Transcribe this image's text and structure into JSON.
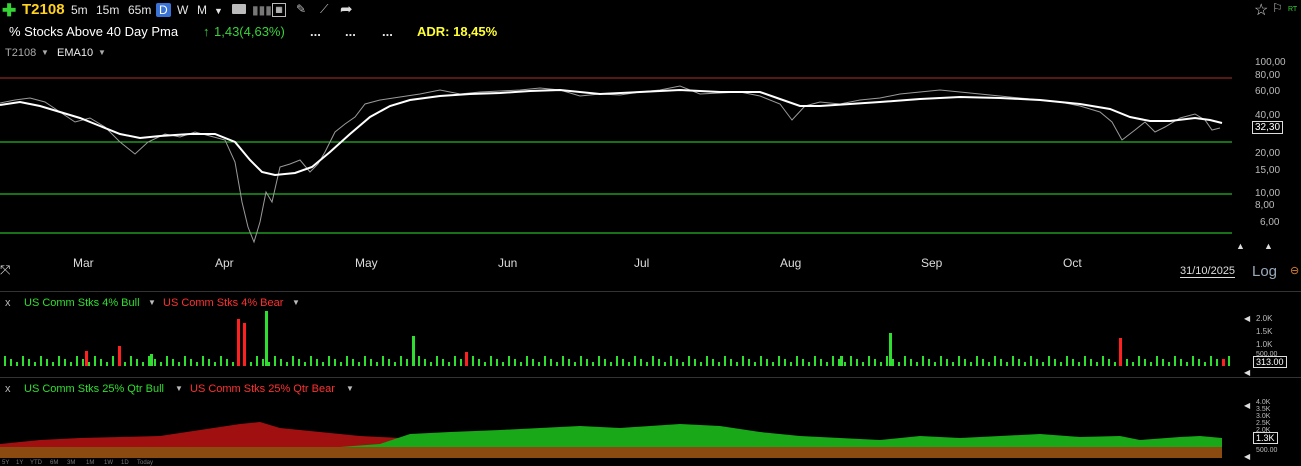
{
  "toolbar": {
    "ticker": "T2108",
    "timeframes": [
      "5m",
      "15m",
      "65m",
      "D",
      "W",
      "M"
    ],
    "active_timeframe": "D"
  },
  "header": {
    "title": "% Stocks Above 40 Day Pma",
    "change": "1,43(4,63%)",
    "dots": [
      "...",
      "...",
      "..."
    ],
    "adr": "ADR: 18,45%"
  },
  "main_chart": {
    "symbol_label": "T2108",
    "indicator_label": "EMA10",
    "y_ticks": [
      "100,00",
      "80,00",
      "60,00",
      "40,00",
      "20,00",
      "15,00",
      "10,00",
      "8,00",
      "6,00"
    ],
    "last_value": "32,30",
    "months": [
      "Mar",
      "Apr",
      "May",
      "Jun",
      "Jul",
      "Aug",
      "Sep",
      "Oct"
    ],
    "date": "31/10/2025",
    "scale_label": "Log",
    "colors": {
      "price_line": "#9a9a9a",
      "ema_line": "#ffffff",
      "upper_band": "#b0302a",
      "mid_lines": "#2fdf2f"
    }
  },
  "panel1": {
    "close": "x",
    "bull_label": "US Comm Stks 4% Bull",
    "bear_label": "US Comm Stks 4% Bear",
    "y_ticks": [
      "2.0K",
      "1.5K",
      "1.0K",
      "500.00"
    ],
    "last_value": "313.00"
  },
  "panel2": {
    "close": "x",
    "bull_label": "US Comm Stks 25% Qtr Bull",
    "bear_label": "US Comm Stks 25% Qtr Bear",
    "y_ticks": [
      "4.0K",
      "3.5K",
      "3.0K",
      "2.5K",
      "2.0K",
      "500.00"
    ],
    "last_value": "1.3K"
  },
  "range_buttons": [
    "5Y",
    "1Y",
    "YTD",
    "6M",
    "3M",
    "1M",
    "1W",
    "1D",
    "Today"
  ]
}
